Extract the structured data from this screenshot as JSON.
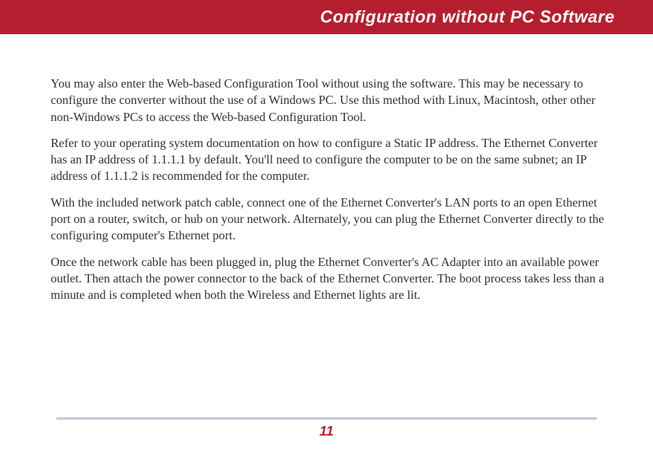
{
  "header": {
    "title": "Configuration without PC Software"
  },
  "body": {
    "paragraphs": [
      "You may also enter the Web-based Configuration Tool without using the software.  This may be necessary to configure the converter without the use of a Windows PC.  Use this method with Linux, Macintosh, other other non-Windows PCs to access the Web-based Configuration Tool.",
      "Refer to your operating system documentation on how to configure a Static IP address.  The Ethernet Converter has an IP address of 1.1.1.1 by default.  You'll need to configure the computer to be on the same subnet; an IP address of 1.1.1.2 is recommended for the computer.",
      "With the included network patch cable, connect one of the Ethernet Converter's LAN ports to an open Ethernet port on a router, switch, or hub on your network.  Alternately, you can plug the Ethernet Converter directly to the configuring computer's Ethernet port.",
      "Once the network cable has been plugged in, plug the Ethernet Converter's AC Adapter into an available power outlet.  Then attach the power connector to the back of the Ethernet Converter.  The boot process takes less than a minute and is completed when both the Wireless and Ethernet lights are lit."
    ]
  },
  "footer": {
    "page_number": "11"
  }
}
